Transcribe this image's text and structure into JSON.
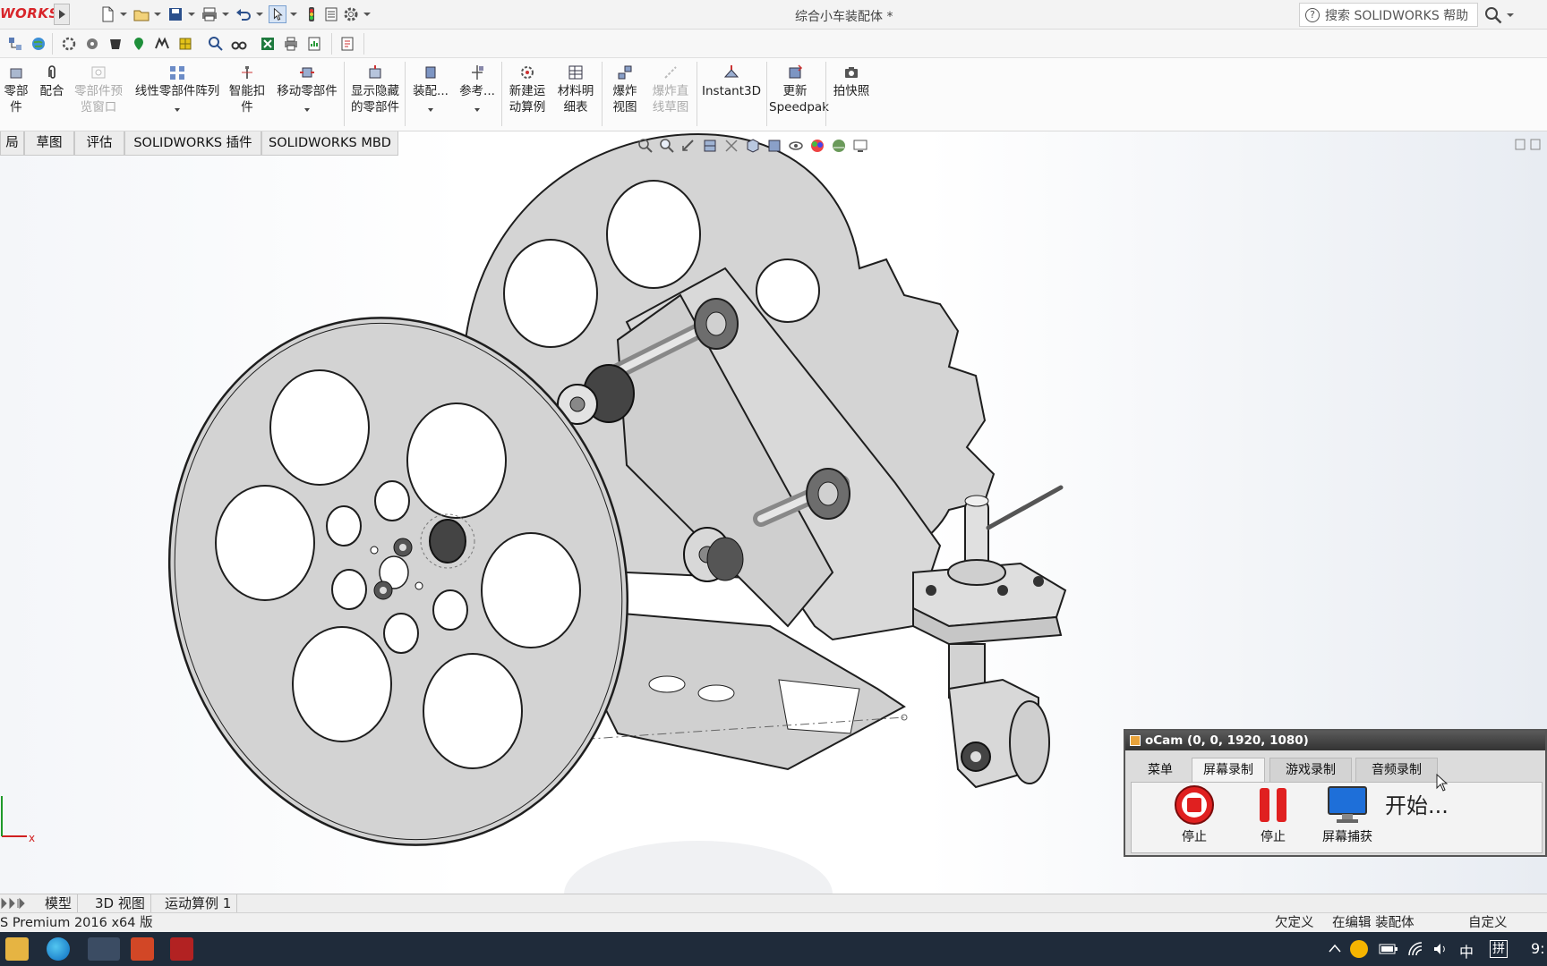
{
  "titlebar": {
    "brand": "WORKS",
    "document_title": "综合小车装配体 *",
    "search_placeholder": "搜索 SOLIDWORKS 帮助",
    "help_glyph": "?"
  },
  "commands": [
    {
      "id": "part",
      "label": "零部件"
    },
    {
      "id": "mate",
      "label": "配合"
    },
    {
      "id": "preview",
      "label": "零部件预览窗口",
      "disabled": true
    },
    {
      "id": "linear-pattern",
      "label": "线性零部件阵列"
    },
    {
      "id": "smart-fastener",
      "label": "智能扣件"
    },
    {
      "id": "move-component",
      "label": "移动零部件"
    },
    {
      "id": "show-hidden",
      "label": "显示隐藏的零部件"
    },
    {
      "id": "assembly-features",
      "label": "装配..."
    },
    {
      "id": "reference",
      "label": "参考..."
    },
    {
      "id": "new-motion",
      "label": "新建运动算例"
    },
    {
      "id": "bom",
      "label": "材料明细表"
    },
    {
      "id": "exploded-view",
      "label": "爆炸视图"
    },
    {
      "id": "explode-line",
      "label": "爆炸直线草图",
      "disabled": true
    },
    {
      "id": "instant3d",
      "label": "Instant3D"
    },
    {
      "id": "speedpak",
      "label": "更新Speedpak"
    },
    {
      "id": "snapshot",
      "label": "拍快照"
    }
  ],
  "tabs": [
    {
      "label": "局"
    },
    {
      "label": "草图"
    },
    {
      "label": "评估"
    },
    {
      "label": "SOLIDWORKS 插件"
    },
    {
      "label": "SOLIDWORKS MBD"
    }
  ],
  "bottom_tabs": [
    {
      "label": "模型"
    },
    {
      "label": "3D 视图"
    },
    {
      "label": "运动算例 1"
    }
  ],
  "status": {
    "edition": "S Premium 2016 x64 版",
    "definition": "欠定义",
    "mode": "在编辑 装配体",
    "custom": "自定义"
  },
  "axis": {
    "x_label": "x"
  },
  "ocam": {
    "title": "oCam (0, 0, 1920, 1080)",
    "tabs": [
      {
        "label": "菜单"
      },
      {
        "label": "屏幕录制"
      },
      {
        "label": "游戏录制"
      },
      {
        "label": "音频录制"
      }
    ],
    "buttons": [
      {
        "label": "停止"
      },
      {
        "label": "停止"
      },
      {
        "label": "屏幕捕获"
      }
    ],
    "start_text": "开始..."
  },
  "taskbar": {
    "ime": "中",
    "ime2": "拼",
    "clock": "9:"
  },
  "colors": {
    "brand": "#d8262b",
    "taskbar": "#1f2b3a",
    "accent_blue": "#1e6fd9",
    "record_red": "#e02020"
  }
}
